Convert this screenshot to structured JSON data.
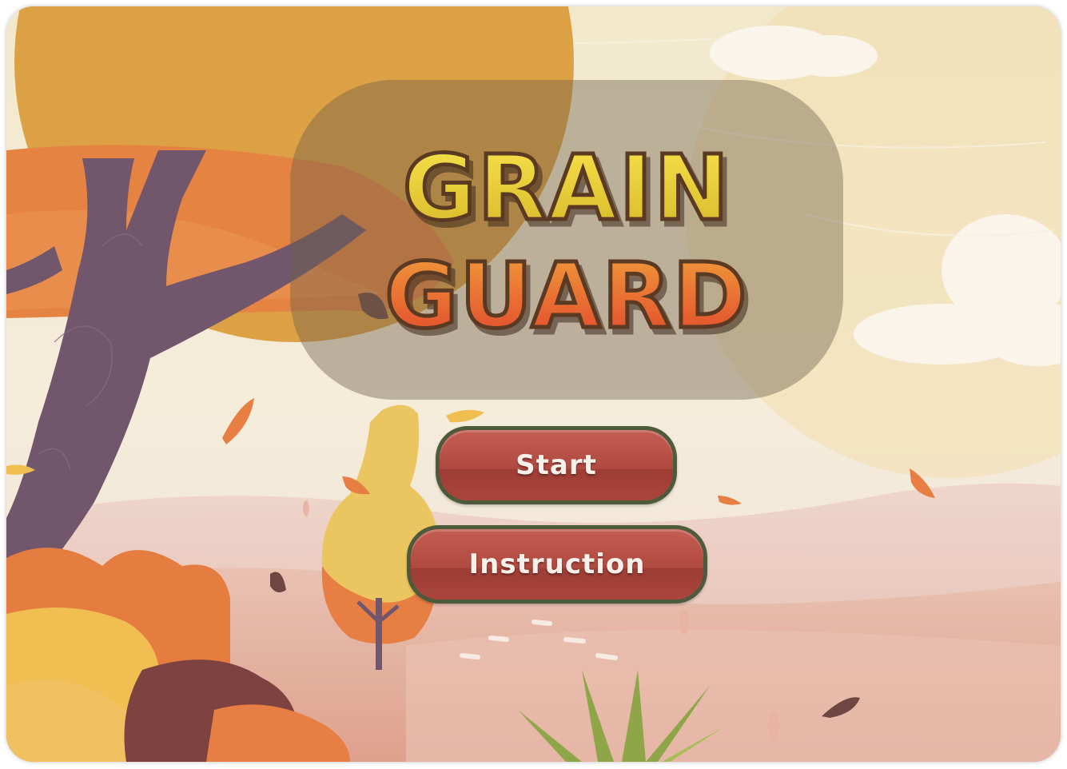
{
  "game": {
    "title_line_1": "GRAIN",
    "title_line_2": "GUARD",
    "menu": {
      "start_label": "Start",
      "instruction_label": "Instruction"
    }
  },
  "colors": {
    "title_top": "#e9cf38",
    "title_bottom": "#e5602f",
    "button_fill": "#b04a40",
    "button_border": "#4d5a3c",
    "sky": "#efe3c2"
  },
  "scene": {
    "theme": "autumn landscape",
    "elements": [
      "large-tree-icon",
      "small-tree-icon",
      "falling-leaf-icon",
      "cloud-icon",
      "bush-icon",
      "grass-icon",
      "sun-icon"
    ]
  }
}
